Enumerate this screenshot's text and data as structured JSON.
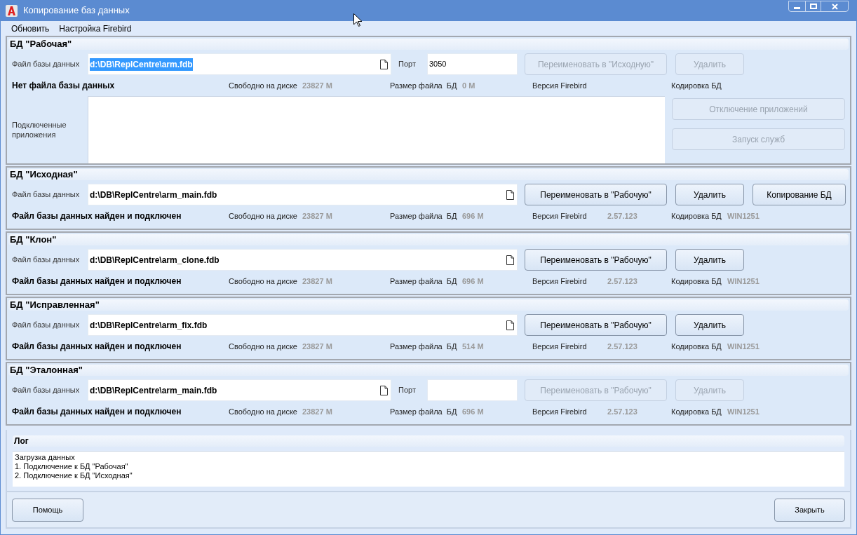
{
  "window": {
    "title": "Копирование баз данных"
  },
  "menu": [
    {
      "label": "Обновить"
    },
    {
      "label": "Настройка Firebird"
    }
  ],
  "sections": [
    {
      "title": "БД \"Рабочая\"",
      "file_label": "Файл базы данных",
      "file": "d:\\DB\\ReplCentre\\arm.fdb",
      "file_selected": true,
      "port": {
        "label": "Порт",
        "value": "3050"
      },
      "buttons": [
        {
          "kind": "rename",
          "label": "Переименовать в \"Исходную\"",
          "disabled": true
        },
        {
          "kind": "delete",
          "label": "Удалить",
          "disabled": true
        }
      ],
      "status": "Нет файла базы данных",
      "free_label": "Свободно на диске",
      "free_value": "23827 M",
      "size_label": "Размер файла  БД",
      "size_value": "0 M",
      "version_label": "Версия Firebird",
      "encoding_label": "Кодировка БД",
      "apps": {
        "label": "Подключенные приложения",
        "buttons": [
          {
            "label": "Отключение приложений",
            "disabled": true
          },
          {
            "label": "Запуск служб",
            "disabled": true
          }
        ]
      }
    },
    {
      "title": "БД \"Исходная\"",
      "file_label": "Файл базы данных",
      "file": "d:\\DB\\ReplCentre\\arm_main.fdb",
      "file_selected": false,
      "buttons": [
        {
          "kind": "rename",
          "label": "Переименовать в \"Рабочую\"",
          "disabled": false
        },
        {
          "kind": "delete",
          "label": "Удалить",
          "disabled": false
        },
        {
          "kind": "copy",
          "label": "Копирование БД",
          "disabled": false
        }
      ],
      "status": "Файл базы данных найден и подключен",
      "free_label": "Свободно на диске",
      "free_value": "23827 M",
      "size_label": "Размер файла  БД",
      "size_value": "696 M",
      "version_label": "Версия Firebird",
      "version_value": "2.57.123",
      "encoding_label": "Кодировка БД",
      "encoding_value": "WIN1251"
    },
    {
      "title": "БД \"Клон\"",
      "file_label": "Файл базы данных",
      "file": "d:\\DB\\ReplCentre\\arm_clone.fdb",
      "file_selected": false,
      "buttons": [
        {
          "kind": "rename",
          "label": "Переименовать в \"Рабочую\"",
          "disabled": false
        },
        {
          "kind": "delete",
          "label": "Удалить",
          "disabled": false
        }
      ],
      "status": "Файл базы данных найден и подключен",
      "free_label": "Свободно на диске",
      "free_value": "23827 M",
      "size_label": "Размер файла  БД",
      "size_value": "696 M",
      "version_label": "Версия Firebird",
      "version_value": "2.57.123",
      "encoding_label": "Кодировка БД",
      "encoding_value": "WIN1251"
    },
    {
      "title": "БД \"Исправленная\"",
      "file_label": "Файл базы данных",
      "file": "d:\\DB\\ReplCentre\\arm_fix.fdb",
      "file_selected": false,
      "buttons": [
        {
          "kind": "rename",
          "label": "Переименовать в \"Рабочую\"",
          "disabled": false
        },
        {
          "kind": "delete",
          "label": "Удалить",
          "disabled": false
        }
      ],
      "status": "Файл базы данных найден и подключен",
      "free_label": "Свободно на диске",
      "free_value": "23827 M",
      "size_label": "Размер файла  БД",
      "size_value": "514 M",
      "version_label": "Версия Firebird",
      "version_value": "2.57.123",
      "encoding_label": "Кодировка БД",
      "encoding_value": "WIN1251"
    },
    {
      "title": "БД \"Эталонная\"",
      "file_label": "Файл базы данных",
      "file": "d:\\DB\\ReplCentre\\arm_main.fdb",
      "file_selected": false,
      "port": {
        "label": "Порт"
      },
      "buttons": [
        {
          "kind": "rename",
          "label": "Переименовать в \"Рабочую\"",
          "disabled": true
        },
        {
          "kind": "delete",
          "label": "Удалить",
          "disabled": true
        }
      ],
      "status": "Файл базы данных найден и подключен",
      "free_label": "Свободно на диске",
      "free_value": "23827 M",
      "size_label": "Размер файла  БД",
      "size_value": "696 M",
      "version_label": "Версия Firebird",
      "version_value": "2.57.123",
      "encoding_label": "Кодировка БД",
      "encoding_value": "WIN1251"
    }
  ],
  "log": {
    "title": "Лог",
    "lines": [
      "Загрузка данных",
      "1. Подключение к БД \"Рабочая\"",
      "2. Подключение к БД \"Исходная\""
    ]
  },
  "footer": {
    "help": "Помощь",
    "close": "Закрыть"
  }
}
